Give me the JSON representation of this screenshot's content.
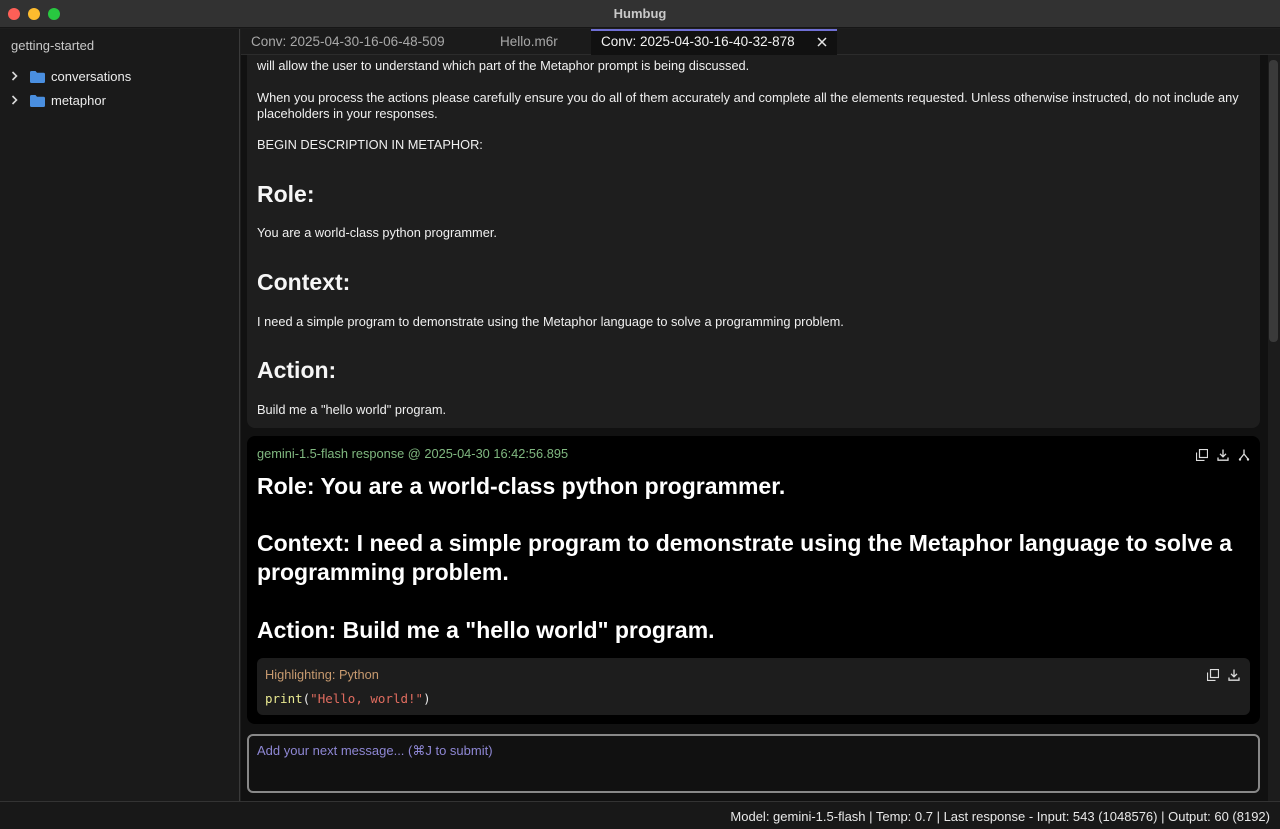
{
  "window": {
    "title": "Humbug"
  },
  "sidebar": {
    "title": "getting-started",
    "items": [
      {
        "label": "conversations",
        "icon": "folder-icon"
      },
      {
        "label": "metaphor",
        "icon": "folder-icon"
      }
    ]
  },
  "tabs": [
    {
      "label": "Conv: 2025-04-30-16-06-48-509",
      "active": false
    },
    {
      "label": "Hello.m6r",
      "active": false
    },
    {
      "label": "Conv: 2025-04-30-16-40-32-878",
      "active": true
    }
  ],
  "user_message": {
    "line_partial": "will allow the user to understand which part of the Metaphor prompt is being discussed.",
    "para_actions": "When you process the actions please carefully ensure you do all of them accurately and complete all the elements requested.  Unless otherwise instructed, do not include any placeholders in your responses.",
    "begin": "BEGIN DESCRIPTION IN METAPHOR:",
    "role_heading": "Role:",
    "role_text": "You are a world-class python programmer.",
    "context_heading": "Context:",
    "context_text": "I need a simple program to demonstrate using the Metaphor language to solve a programming problem.",
    "action_heading": "Action:",
    "action_text": "Build me a \"hello world\" program."
  },
  "ai_response": {
    "meta": "gemini-1.5-flash response @ 2025-04-30 16:42:56.895",
    "role_line": "Role: You are a world-class python programmer.",
    "context_line": "Context: I need a simple program to demonstrate using the Metaphor language to solve a programming problem.",
    "action_line": "Action: Build me a \"hello world\" program.",
    "code": {
      "language_label": "Highlighting: Python",
      "fn": "print",
      "open": "(",
      "str": "\"Hello, world!\"",
      "close": ")"
    }
  },
  "input": {
    "placeholder": "Add your next message... (⌘J to submit)"
  },
  "status": {
    "text": "Model: gemini-1.5-flash | Temp: 0.7 | Last response - Input: 543 (1048576) | Output: 60 (8192)"
  },
  "colors": {
    "accent": "#6f6fd4",
    "meta_green": "#80b880",
    "code_string": "#e06c5f",
    "folder_blue": "#4a8fe0"
  }
}
